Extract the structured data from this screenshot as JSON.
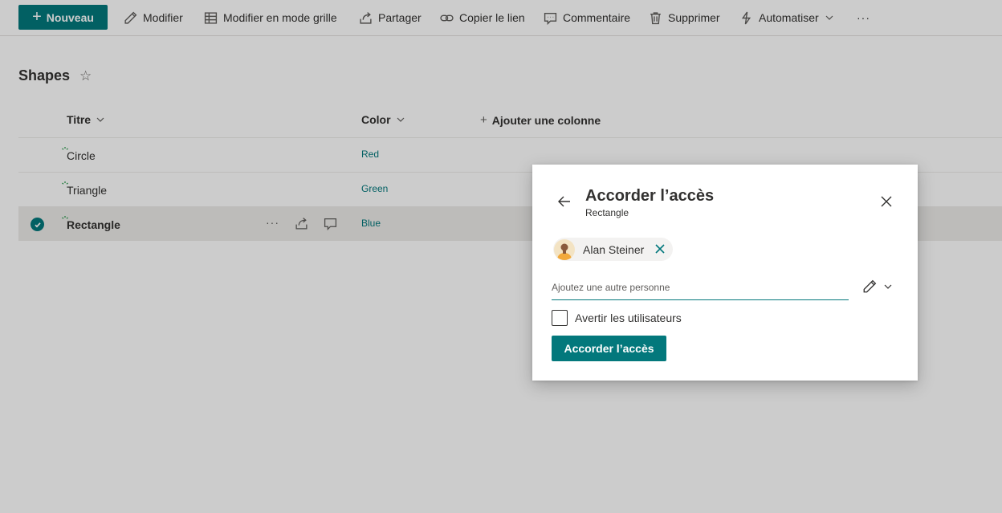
{
  "toolbar": {
    "new_label": "Nouveau",
    "edit_label": "Modifier",
    "grid_label": "Modifier en mode grille",
    "share_label": "Partager",
    "copy_link_label": "Copier le lien",
    "comment_label": "Commentaire",
    "delete_label": "Supprimer",
    "automate_label": "Automatiser",
    "more_label": "···"
  },
  "list": {
    "title": "Shapes",
    "columns": {
      "title": "Titre",
      "color": "Color",
      "add_column": "Ajouter une colonne",
      "add_prefix": "+"
    },
    "rows": [
      {
        "title": "Circle",
        "color": "Red",
        "selected": false
      },
      {
        "title": "Triangle",
        "color": "Green",
        "selected": false
      },
      {
        "title": "Rectangle",
        "color": "Blue",
        "selected": true
      }
    ],
    "row_more": "···"
  },
  "dialog": {
    "title": "Accorder l’accès",
    "subtitle": "Rectangle",
    "person": "Alan Steiner",
    "add_placeholder": "Ajoutez une autre personne",
    "notify_label": "Avertir les utilisateurs",
    "notify_checked": false,
    "grant_button": "Accorder l’accès"
  },
  "colors": {
    "accent": "#03787c",
    "overlay": "rgba(0,0,0,0.2)"
  }
}
